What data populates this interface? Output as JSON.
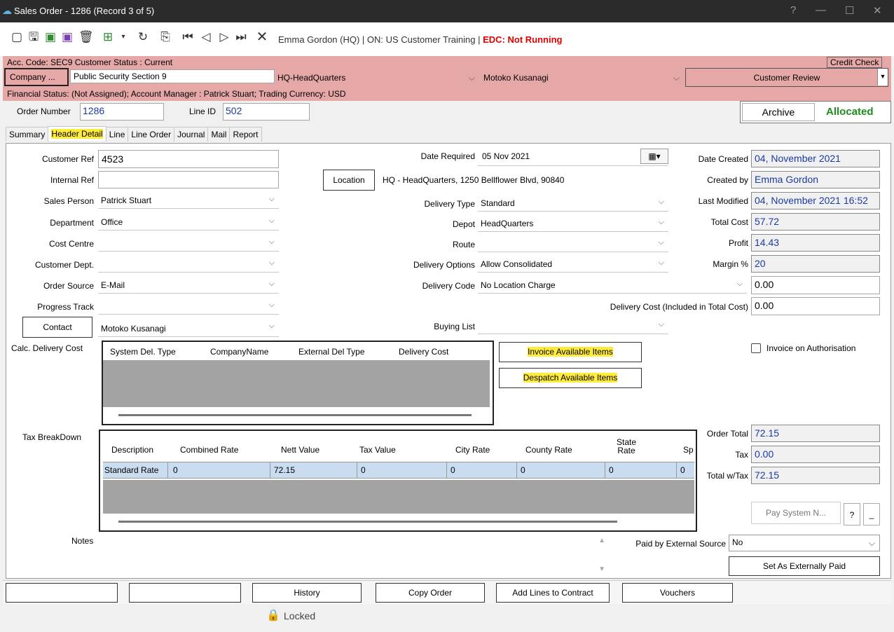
{
  "title": "Sales Order - 1286  (Record 3 of 5)",
  "window_controls": {
    "help": "?",
    "min": "—",
    "max": "☐",
    "close": "✕"
  },
  "toolbar": {
    "user_info": "Emma Gordon (HQ) | ON: US Customer Training |",
    "edc_status": "EDC: Not Running"
  },
  "header": {
    "acc_code_line": "Acc. Code: SEC9  Customer Status : Current",
    "credit_check": "Credit Check",
    "company_btn": "Company ...",
    "company_name": "Public Security Section 9",
    "site": "HQ-HeadQuarters",
    "contact": "Motoko Kusanagi",
    "customer_review": "Customer Review",
    "financial_line": "Financial Status: (Not Assigned);  Account Manager : Patrick Stuart; Trading Currency: USD",
    "order_number_label": "Order Number",
    "order_number": "1286",
    "line_id_label": "Line ID",
    "line_id": "502",
    "archive": "Archive",
    "allocated": "Allocated"
  },
  "tabs": [
    "Summary",
    "Header Detail",
    "Line",
    "Line Order",
    "Journal",
    "Mail",
    "Report"
  ],
  "left_fields": {
    "customer_ref_label": "Customer Ref",
    "customer_ref": "4523",
    "internal_ref_label": "Internal Ref",
    "internal_ref": "",
    "sales_person_label": "Sales Person",
    "sales_person": "Patrick Stuart",
    "department_label": "Department",
    "department": "Office",
    "cost_centre_label": "Cost Centre",
    "cost_centre": "",
    "customer_dept_label": "Customer Dept.",
    "customer_dept": "",
    "order_source_label": "Order Source",
    "order_source": "E-Mail",
    "progress_track_label": "Progress Track",
    "progress_track": "",
    "contact_btn": "Contact",
    "contact": "Motoko Kusanagi"
  },
  "mid_fields": {
    "date_required_label": "Date Required",
    "date_required": "05 Nov 2021",
    "location_btn": "Location",
    "location": "HQ - HeadQuarters, 1250 Bellflower Blvd, 90840",
    "delivery_type_label": "Delivery Type",
    "delivery_type": "Standard",
    "depot_label": "Depot",
    "depot": "HeadQuarters",
    "route_label": "Route",
    "route": "",
    "delivery_options_label": "Delivery Options",
    "delivery_options": "Allow Consolidated",
    "delivery_code_label": "Delivery Code",
    "delivery_code": "No Location Charge",
    "delivery_code_value": "0.00",
    "delivery_cost_label": "Delivery Cost (Included in Total Cost)",
    "delivery_cost": "0.00",
    "buying_list_label": "Buying List",
    "buying_list": ""
  },
  "right_fields": {
    "date_created_label": "Date Created",
    "date_created": "04, November 2021",
    "created_by_label": "Created by",
    "created_by": "Emma Gordon",
    "last_modified_label": "Last Modified",
    "last_modified": "04, November 2021  16:52",
    "total_cost_label": "Total Cost",
    "total_cost": "57.72",
    "profit_label": "Profit",
    "profit": "14.43",
    "margin_label": "Margin %",
    "margin": "20"
  },
  "calc_delivery": {
    "label": "Calc. Delivery Cost",
    "columns": [
      "System Del. Type",
      "CompanyName",
      "External Del Type",
      "Delivery Cost"
    ]
  },
  "actions": {
    "invoice_available": "Invoice Available Items",
    "despatch_available": "Despatch Available Items",
    "invoice_on_auth": "Invoice on Authorisation"
  },
  "tax": {
    "label": "Tax BreakDown",
    "columns": [
      "Description",
      "Combined Rate",
      "Nett Value",
      "Tax Value",
      "City Rate",
      "County Rate",
      "State Rate",
      "Sp"
    ],
    "row": [
      "Standard Rate",
      "0",
      "72.15",
      "0",
      "0",
      "0",
      "0",
      "0"
    ]
  },
  "totals": {
    "order_total_label": "Order Total",
    "order_total": "72.15",
    "tax_label": "Tax",
    "tax": "0.00",
    "total_wtax_label": "Total w/Tax",
    "total_wtax": "72.15",
    "pay_system": "Pay System N...",
    "help": "?",
    "minus": "_"
  },
  "notes_label": "Notes",
  "paid_ext_label": "Paid by External Source",
  "paid_ext": "No",
  "set_ext_paid": "Set As Externally Paid",
  "bottom_buttons": [
    "",
    "",
    "History",
    "Copy Order",
    "Add Lines to Contract",
    "Vouchers"
  ],
  "locked": "Locked",
  "colors": {
    "band": "#e6a7a7",
    "highlight": "#ffeb3b",
    "allocated": "#1e8c1e",
    "edc": "#e00000",
    "value_blue": "#1a3aa6"
  }
}
